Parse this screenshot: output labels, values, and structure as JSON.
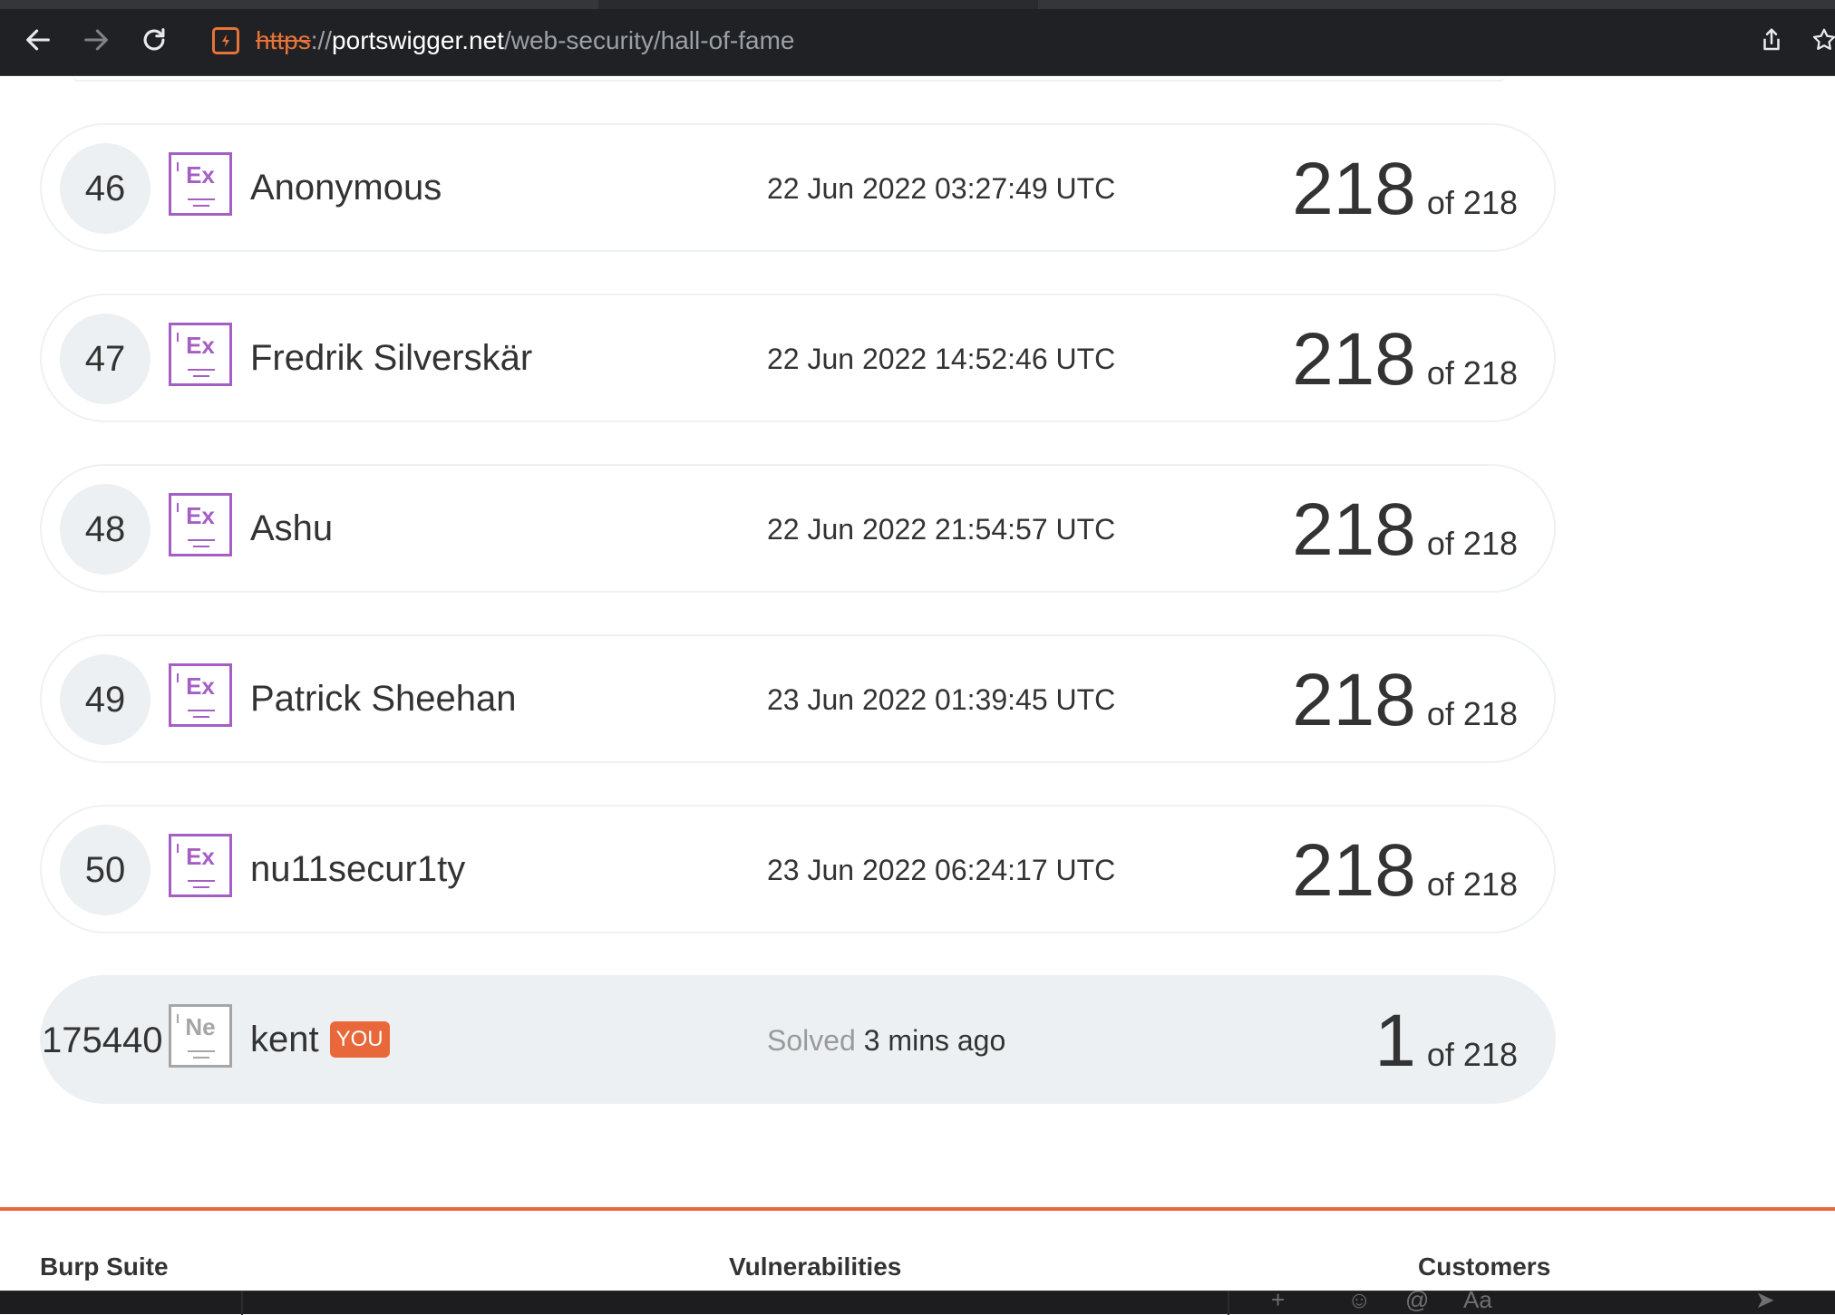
{
  "browser": {
    "url_scheme": "https",
    "url_separator": "://",
    "url_host": "portswigger.net",
    "url_path": "/web-security/hall-of-fame",
    "icons": [
      "back-arrow-icon",
      "forward-arrow-icon",
      "reload-icon",
      "site-info-icon",
      "share-icon",
      "bookmark-star-icon"
    ]
  },
  "leaderboard": {
    "rows": [
      {
        "rank": "46",
        "badge": "Ex",
        "name": "Anonymous",
        "date": "22 Jun 2022 03:27:49 UTC",
        "score": "218",
        "of": "of 218"
      },
      {
        "rank": "47",
        "badge": "Ex",
        "name": "Fredrik Silverskär",
        "date": "22 Jun 2022 14:52:46 UTC",
        "score": "218",
        "of": "of 218"
      },
      {
        "rank": "48",
        "badge": "Ex",
        "name": "Ashu",
        "date": "22 Jun 2022 21:54:57 UTC",
        "score": "218",
        "of": "of 218"
      },
      {
        "rank": "49",
        "badge": "Ex",
        "name": "Patrick Sheehan",
        "date": "23 Jun 2022 01:39:45 UTC",
        "score": "218",
        "of": "of 218"
      },
      {
        "rank": "50",
        "badge": "Ex",
        "name": "nu11secur1ty",
        "date": "23 Jun 2022 06:24:17 UTC",
        "score": "218",
        "of": "of 218"
      }
    ],
    "current_user": {
      "rank": "175440",
      "badge": "Ne",
      "name": "kent",
      "you_tag": "YOU",
      "solved_label": "Solved",
      "solved_time": "3 mins ago",
      "score": "1",
      "of": "of 218"
    }
  },
  "footer": {
    "headings": [
      "Burp Suite",
      "Vulnerabilities",
      "Customers"
    ]
  },
  "colors": {
    "accent": "#e8683b",
    "expert_badge": "#a45fc5",
    "novice_badge": "#a6a6a6",
    "row_highlight": "#ecf0f2"
  }
}
